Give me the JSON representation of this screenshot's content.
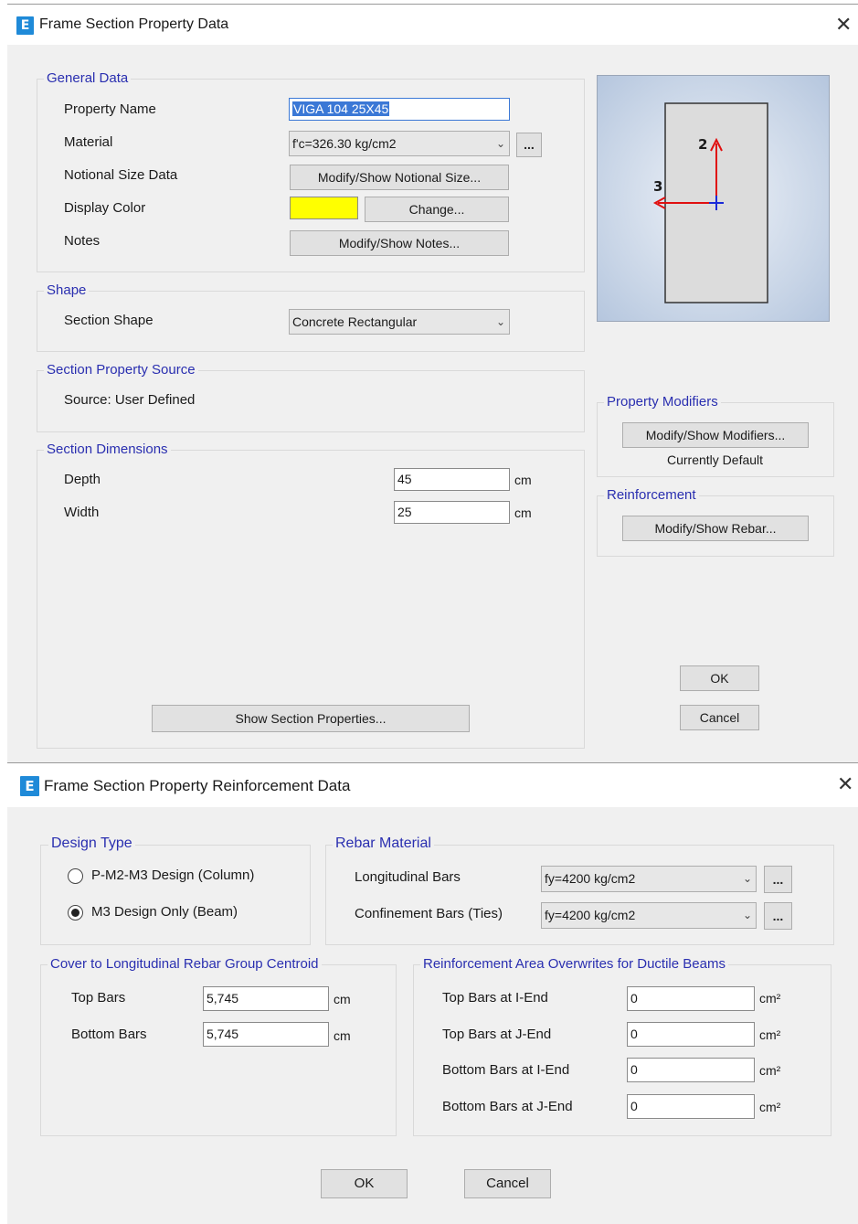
{
  "dialog1": {
    "title": "Frame Section Property Data",
    "app_icon_letter": "E",
    "close_glyph": "✕",
    "general_data": {
      "legend": "General Data",
      "property_name_label": "Property Name",
      "property_name_value": "VIGA 104 25X45",
      "material_label": "Material",
      "material_value": "f'c=326.30 kg/cm2",
      "material_more": "...",
      "notional_label": "Notional Size Data",
      "notional_button": "Modify/Show Notional Size...",
      "display_color_label": "Display Color",
      "display_color": "#ffff00",
      "change_button": "Change...",
      "notes_label": "Notes",
      "notes_button": "Modify/Show Notes..."
    },
    "shape": {
      "legend": "Shape",
      "section_shape_label": "Section Shape",
      "section_shape_value": "Concrete Rectangular"
    },
    "source": {
      "legend": "Section Property Source",
      "source_text": "Source:  User Defined"
    },
    "dimensions": {
      "legend": "Section Dimensions",
      "depth_label": "Depth",
      "depth_value": "45",
      "depth_unit": "cm",
      "width_label": "Width",
      "width_value": "25",
      "width_unit": "cm"
    },
    "preview": {
      "axis2_label": "2",
      "axis3_label": "3"
    },
    "modifiers": {
      "legend": "Property Modifiers",
      "button": "Modify/Show Modifiers...",
      "status": "Currently Default"
    },
    "reinforcement": {
      "legend": "Reinforcement",
      "button": "Modify/Show Rebar..."
    },
    "show_props_button": "Show Section Properties...",
    "ok_button": "OK",
    "cancel_button": "Cancel"
  },
  "dialog2": {
    "title": "Frame Section Property Reinforcement Data",
    "app_icon_letter": "E",
    "close_glyph": "✕",
    "design_type": {
      "legend": "Design Type",
      "option_column": "P-M2-M3 Design  (Column)",
      "option_beam": "M3 Design Only  (Beam)",
      "selected": "M3 Design Only  (Beam)"
    },
    "rebar_material": {
      "legend": "Rebar Material",
      "longitudinal_label": "Longitudinal Bars",
      "longitudinal_value": "fy=4200 kg/cm2",
      "confinement_label": "Confinement Bars (Ties)",
      "confinement_value": "fy=4200 kg/cm2",
      "more": "..."
    },
    "cover": {
      "legend": "Cover to Longitudinal Rebar Group Centroid",
      "top_label": "Top Bars",
      "top_value": "5,745",
      "bottom_label": "Bottom  Bars",
      "bottom_value": "5,745",
      "unit": "cm"
    },
    "overwrites": {
      "legend": "Reinforcement Area Overwrites for Ductile Beams",
      "rows": [
        {
          "label": "Top Bars at I-End",
          "value": "0",
          "unit": "cm²"
        },
        {
          "label": "Top Bars at J-End",
          "value": "0",
          "unit": "cm²"
        },
        {
          "label": "Bottom Bars at I-End",
          "value": "0",
          "unit": "cm²"
        },
        {
          "label": "Bottom Bars at J-End",
          "value": "0",
          "unit": "cm²"
        }
      ]
    },
    "ok_button": "OK",
    "cancel_button": "Cancel"
  }
}
